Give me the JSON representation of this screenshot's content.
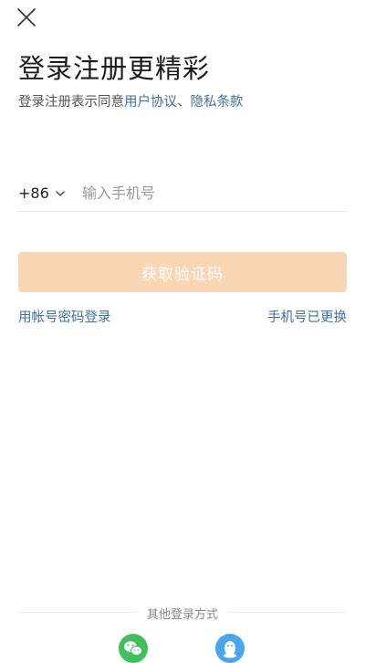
{
  "header": {
    "close_icon": "close-icon"
  },
  "title": "登录注册更精彩",
  "agreement": {
    "prefix": "登录注册表示同意",
    "user_agreement": "用户协议",
    "separator": "、",
    "privacy_policy": "隐私条款"
  },
  "phone": {
    "country_code": "+86",
    "placeholder": "输入手机号",
    "value": ""
  },
  "get_code_button": "获取验证码",
  "links": {
    "account_login": "用帐号密码登录",
    "phone_changed": "手机号已更换"
  },
  "other_login": {
    "label": "其他登录方式",
    "providers": [
      {
        "name": "wechat",
        "icon": "wechat-icon",
        "color": "#3fc05b"
      },
      {
        "name": "qq",
        "icon": "qq-icon",
        "color": "#4aa6ec"
      }
    ]
  },
  "colors": {
    "accent_link": "#3d6fa8",
    "button_disabled": "#fbd6b4"
  }
}
